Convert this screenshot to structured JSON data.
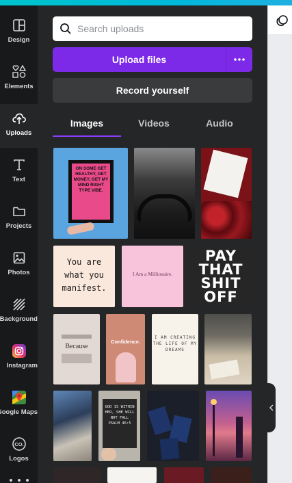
{
  "colors": {
    "accent": "#7d2ae8",
    "tab_underline": "#8b3dff",
    "rail_bg": "#18191b",
    "panel_bg": "#252627"
  },
  "rail": {
    "items": [
      {
        "label": "Design",
        "icon": "design-layout-icon"
      },
      {
        "label": "Elements",
        "icon": "elements-shapes-icon"
      },
      {
        "label": "Uploads",
        "icon": "cloud-upload-icon"
      },
      {
        "label": "Text",
        "icon": "text-t-icon"
      },
      {
        "label": "Projects",
        "icon": "folder-icon"
      },
      {
        "label": "Photos",
        "icon": "photo-icon"
      },
      {
        "label": "Background",
        "icon": "background-hatch-icon"
      },
      {
        "label": "Instagram",
        "icon": "instagram-icon"
      },
      {
        "label": "Google Maps",
        "icon": "google-maps-icon"
      },
      {
        "label": "Logos",
        "icon": "logos-co-icon"
      }
    ]
  },
  "search": {
    "placeholder": "Search uploads"
  },
  "upload": {
    "label": "Upload files",
    "more_icon": "more-dots-icon"
  },
  "record": {
    "label": "Record yourself"
  },
  "tabs": [
    {
      "label": "Images"
    },
    {
      "label": "Videos"
    },
    {
      "label": "Audio"
    }
  ],
  "thumbs": {
    "frame_quote": "ON SOME GET HEALTHY, GET MONEY, GET MY MIND RIGHT TYPE VIBE.",
    "manifest": "You are what you manifest.",
    "millionaire": "I Am a Millionaire.",
    "pay": "PAY THAT SHIT OFF",
    "because": "Because",
    "confidence": "Confidence.",
    "creating": "I AM CREATING THE LIFE OF MY DREAMS",
    "letterboard": "GOD IS WITHIN HER, SHE WILL NOT FALL PSALM 46:5"
  }
}
